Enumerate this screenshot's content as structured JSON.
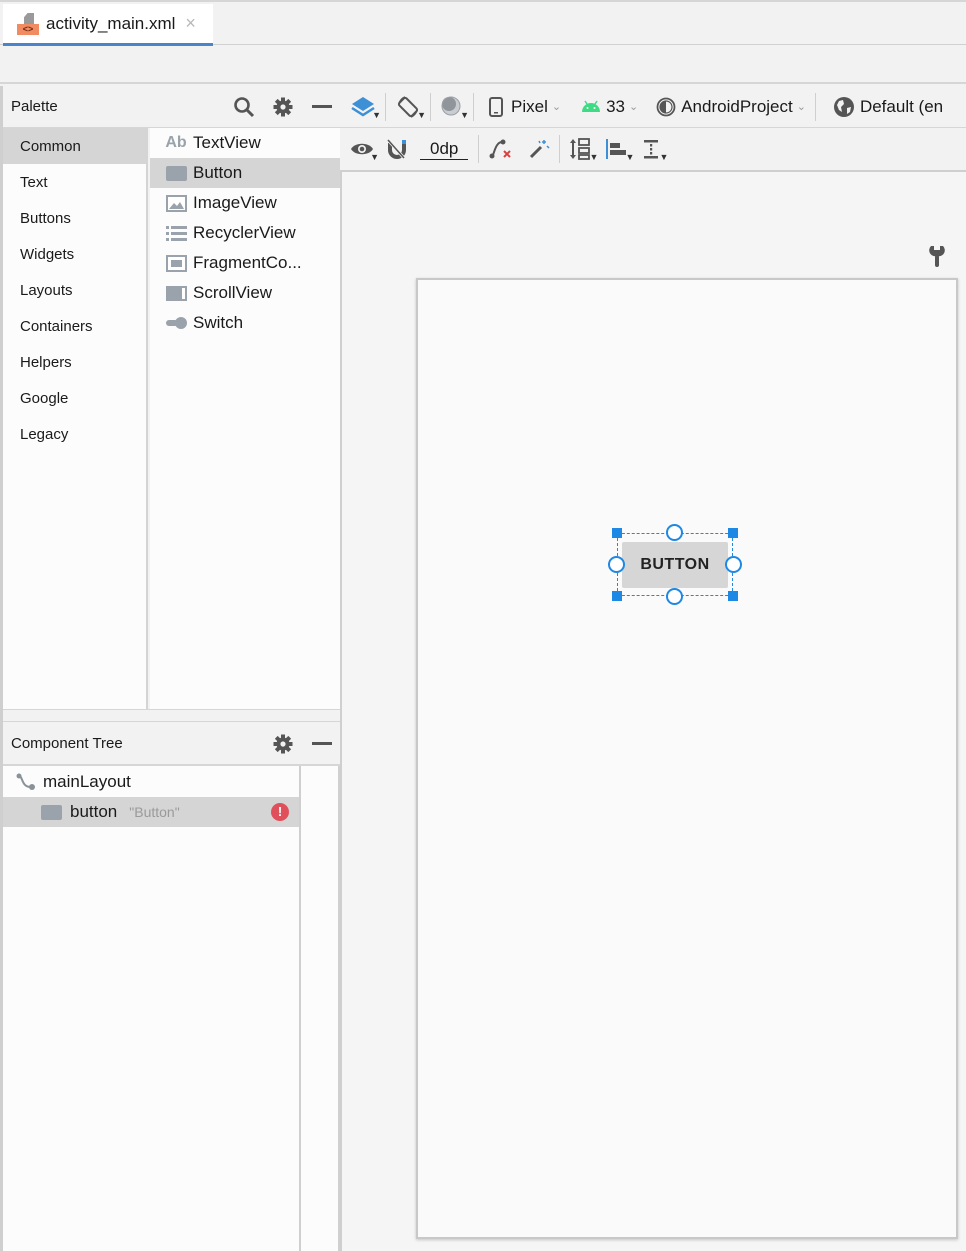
{
  "editor_tab": {
    "label": "activity_main.xml",
    "close": "×"
  },
  "palette": {
    "title": "Palette",
    "categories": [
      {
        "label": "Common",
        "selected": true
      },
      {
        "label": "Text"
      },
      {
        "label": "Buttons"
      },
      {
        "label": "Widgets"
      },
      {
        "label": "Layouts"
      },
      {
        "label": "Containers"
      },
      {
        "label": "Helpers"
      },
      {
        "label": "Google"
      },
      {
        "label": "Legacy"
      }
    ],
    "widgets": [
      {
        "label": "TextView",
        "icon": "textview-icon",
        "glyph": "Ab"
      },
      {
        "label": "Button",
        "icon": "button-icon",
        "selected": true
      },
      {
        "label": "ImageView",
        "icon": "imageview-icon"
      },
      {
        "label": "RecyclerView",
        "icon": "recyclerview-icon"
      },
      {
        "label": "FragmentCo...",
        "icon": "fragmentcontainer-icon"
      },
      {
        "label": "ScrollView",
        "icon": "scrollview-icon"
      },
      {
        "label": "Switch",
        "icon": "switch-icon"
      }
    ]
  },
  "component_tree": {
    "title": "Component Tree",
    "nodes": [
      {
        "label": "mainLayout",
        "icon": "constraint-layout-icon"
      },
      {
        "label": "button",
        "hint": "\"Button\"",
        "icon": "button-icon",
        "selected": true,
        "status": "!"
      }
    ]
  },
  "toolbar": {
    "device": "Pixel",
    "api": "33",
    "theme": "AndroidProject",
    "locale": "Default (en",
    "margin": "0dp"
  },
  "canvas": {
    "button_text": "BUTTON"
  }
}
